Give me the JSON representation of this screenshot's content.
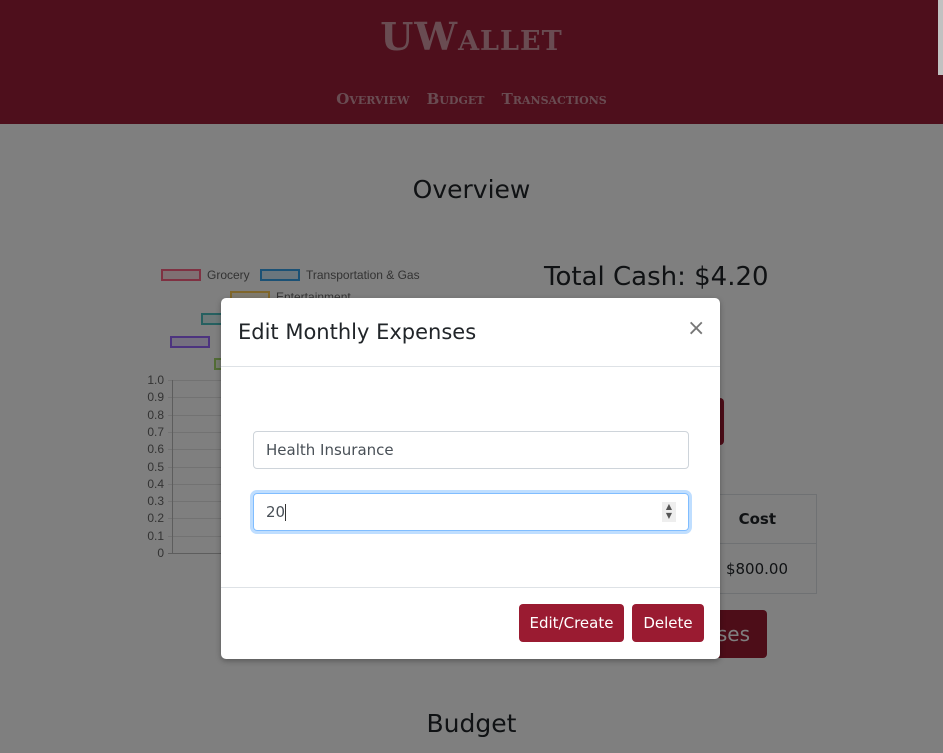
{
  "app": {
    "title": "UWallet",
    "nav": [
      "Overview",
      "Budget",
      "Transactions"
    ]
  },
  "overview": {
    "heading": "Overview",
    "total_cash": "Total Cash: $4.20",
    "table": {
      "header": "Cost",
      "rows": [
        "$800.00"
      ]
    },
    "hidden_button_fragment": "ses"
  },
  "budget": {
    "heading": "Budget"
  },
  "chart_data": {
    "type": "bar",
    "legend": [
      "Grocery",
      "Transportation & Gas",
      "Entertainment"
    ],
    "legend_colors": [
      "#ff6384",
      "#36a2eb",
      "#ffcd56",
      "#4bc0c0",
      "#9966ff",
      "#a5d86a"
    ],
    "ylim": [
      0,
      1.0
    ],
    "yticks": [
      "1.0",
      "0.9",
      "0.8",
      "0.7",
      "0.6",
      "0.5",
      "0.4",
      "0.3",
      "0.2",
      "0.1",
      "0"
    ],
    "grid": true,
    "legend_position": "top"
  },
  "modal": {
    "title": "Edit Monthly Expenses",
    "close": "×",
    "name_value": "Health Insurance",
    "amount_value": "20",
    "edit_label": "Edit/Create",
    "delete_label": "Delete"
  }
}
